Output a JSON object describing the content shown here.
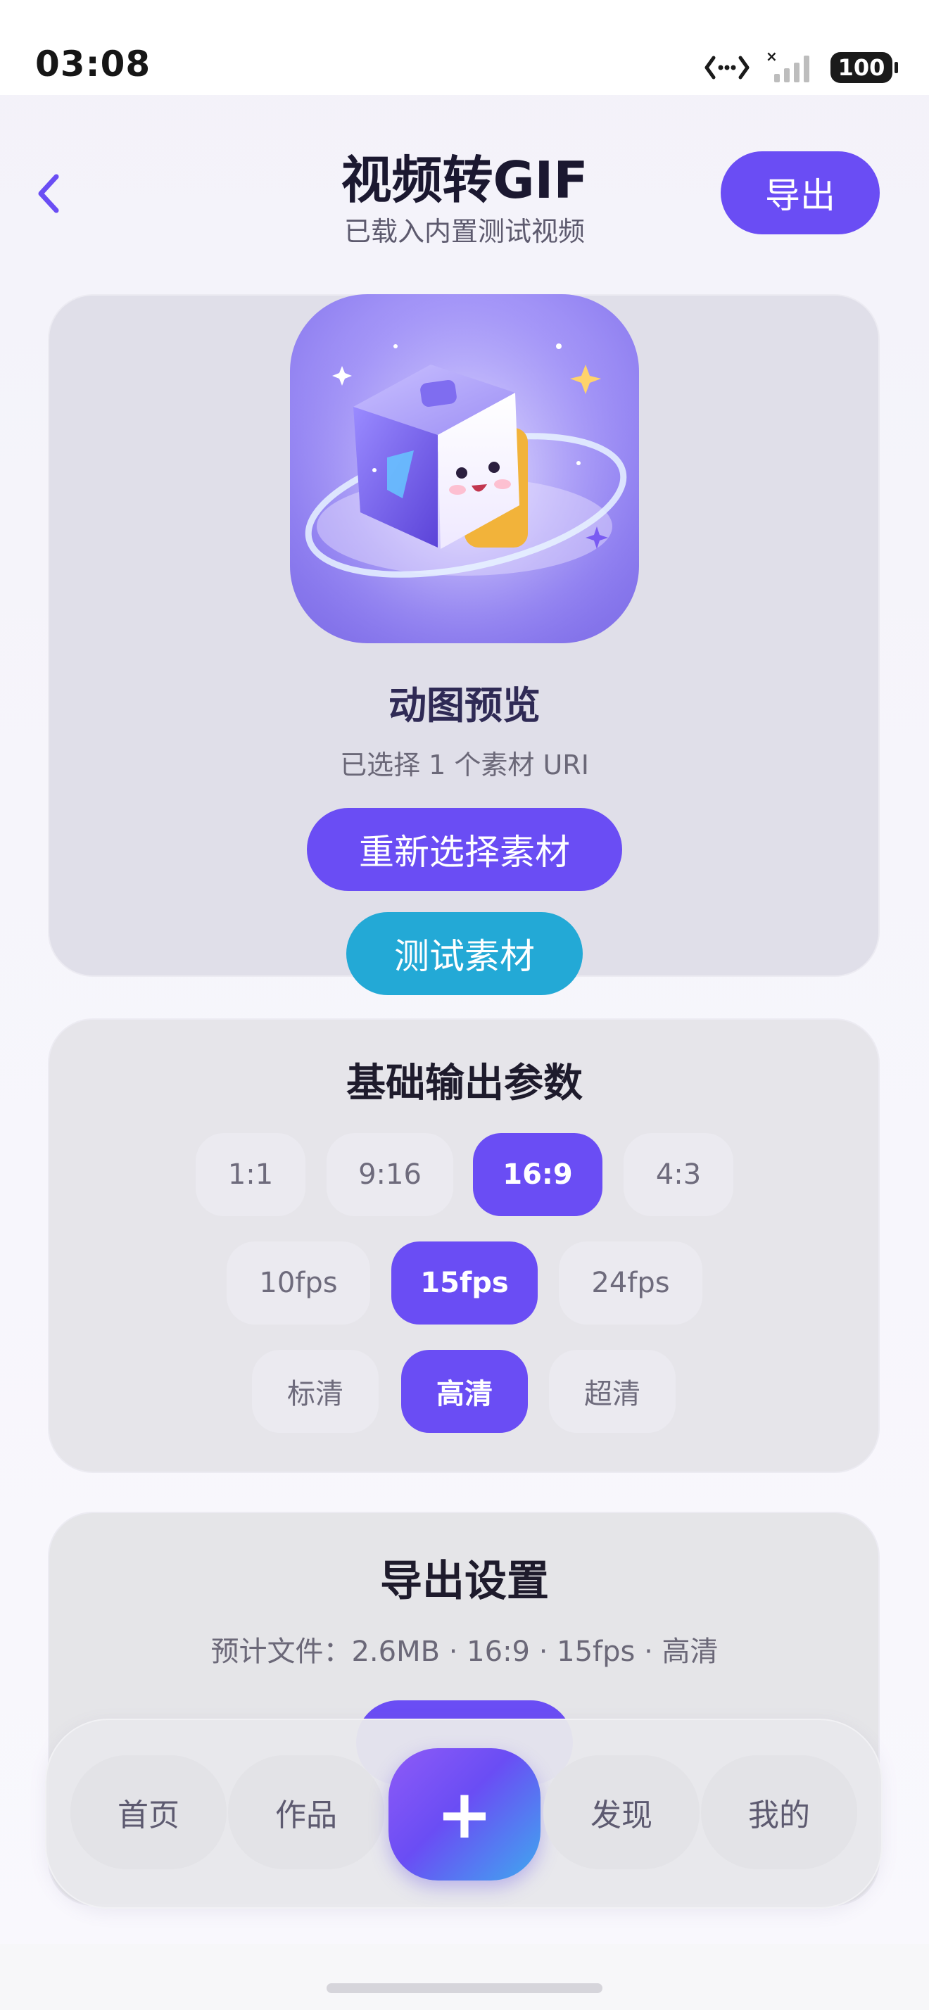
{
  "status_bar": {
    "time": "03:08",
    "battery": "100"
  },
  "header": {
    "title": "视频转GIF",
    "subtitle": "已载入内置测试视频",
    "export_label": "导出"
  },
  "preview": {
    "title": "动图预览",
    "subtitle": "已选择 1 个素材 URI",
    "reselect_label": "重新选择素材",
    "test_label": "测试素材"
  },
  "params": {
    "title": "基础输出参数",
    "ratios": [
      "1:1",
      "9:16",
      "16:9",
      "4:3"
    ],
    "selected_ratio": "16:9",
    "fps": [
      "10fps",
      "15fps",
      "24fps"
    ],
    "selected_fps": "15fps",
    "quality": [
      "标清",
      "高清",
      "超清"
    ],
    "selected_quality": "高清"
  },
  "export_settings": {
    "title": "导出设置",
    "info": "预计文件：2.6MB · 16:9 · 15fps · 高清"
  },
  "tabbar": {
    "home": "首页",
    "works": "作品",
    "add": "+",
    "discover": "发现",
    "mine": "我的"
  },
  "colors": {
    "accent": "#6a4df4",
    "test_button": "#23a9d6",
    "title": "#1b1830"
  }
}
